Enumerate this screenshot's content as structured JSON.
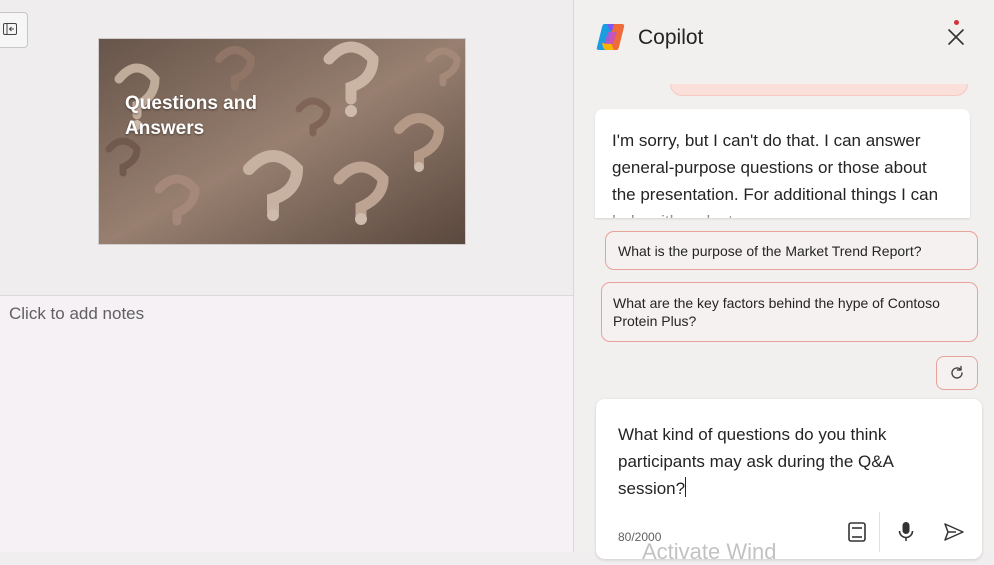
{
  "editor": {
    "slide": {
      "title": "Questions and Answers"
    },
    "notes": {
      "placeholder": "Click to add notes"
    }
  },
  "copilot": {
    "title": "Copilot",
    "response": "I'm sorry, but I can't do that. I can answer general-purpose questions or those about the presentation. For additional things I can help with, select",
    "suggestions": [
      "What is the purpose of the Market Trend Report?",
      "What are the key factors behind the hype of Contoso Protein Plus?"
    ],
    "composer": {
      "value": "What kind of questions do you think participants may ask during the Q&A session?",
      "char_count": "80/2000"
    },
    "watermark": "Activate Wind"
  },
  "icons": [
    "collapse-pane-icon",
    "copilot-logo-icon",
    "close-icon",
    "refresh-icon",
    "notebook-icon",
    "microphone-icon",
    "send-icon"
  ],
  "colors": {
    "accent_border": "#e6a39a",
    "notification_dot": "#d13438"
  }
}
